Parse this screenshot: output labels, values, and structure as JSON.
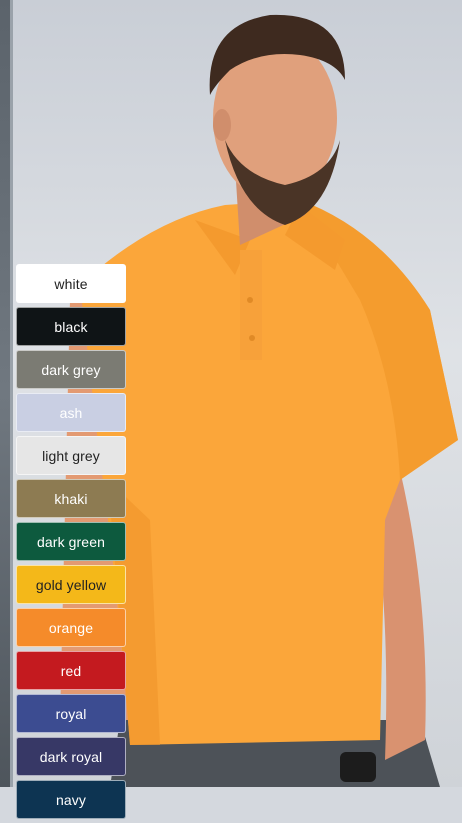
{
  "swatches": [
    {
      "label": "white",
      "bg": "#ffffff",
      "fg": "#222222"
    },
    {
      "label": "black",
      "bg": "#0f1416",
      "fg": "#ffffff"
    },
    {
      "label": "dark grey",
      "bg": "#7b7b73",
      "fg": "#ffffff"
    },
    {
      "label": "ash",
      "bg": "#c9cfe3",
      "fg": "#ffffff"
    },
    {
      "label": "light grey",
      "bg": "#e6e6e6",
      "fg": "#222222"
    },
    {
      "label": "khaki",
      "bg": "#8d7b52",
      "fg": "#ffffff"
    },
    {
      "label": "dark green",
      "bg": "#0d5a3e",
      "fg": "#ffffff"
    },
    {
      "label": "gold yellow",
      "bg": "#f4b819",
      "fg": "#222222"
    },
    {
      "label": "orange",
      "bg": "#f58b2a",
      "fg": "#ffffff"
    },
    {
      "label": "red",
      "bg": "#c41a1f",
      "fg": "#ffffff"
    },
    {
      "label": "royal",
      "bg": "#3c4c91",
      "fg": "#ffffff"
    },
    {
      "label": "dark royal",
      "bg": "#373866",
      "fg": "#ffffff"
    },
    {
      "label": "navy",
      "bg": "#0d3452",
      "fg": "#ffffff"
    }
  ]
}
